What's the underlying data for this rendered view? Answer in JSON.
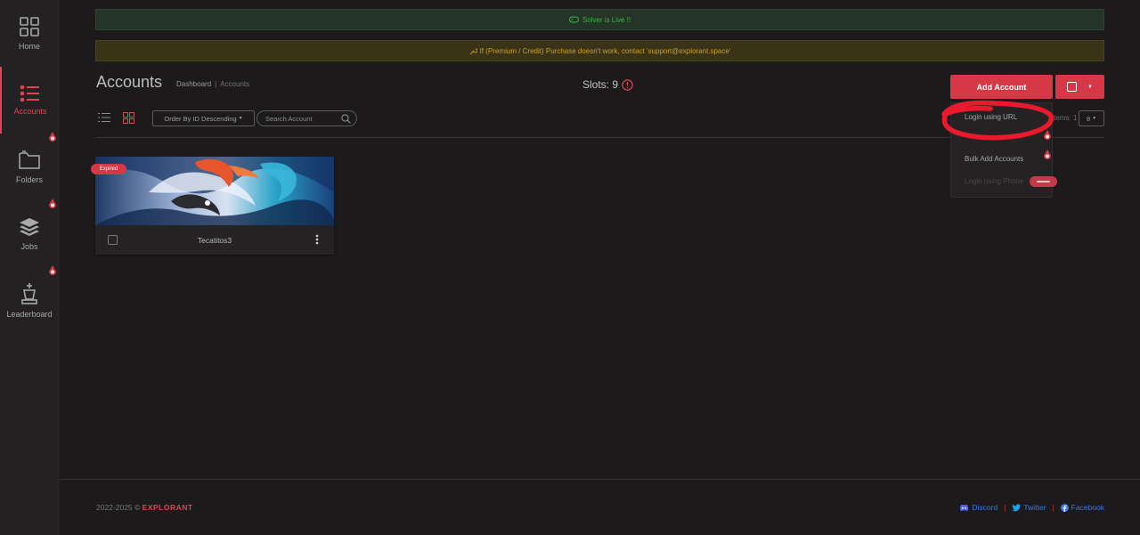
{
  "sidebar": {
    "items": [
      {
        "label": "Home",
        "icon": "grid-icon"
      },
      {
        "label": "Accounts",
        "icon": "list-icon"
      },
      {
        "label": "Folders",
        "icon": "folder-icon"
      },
      {
        "label": "Jobs",
        "icon": "layers-icon"
      },
      {
        "label": "Leaderboard",
        "icon": "chess-king-icon"
      }
    ]
  },
  "banners": {
    "live": "Solver is Live !!",
    "warning": "If (Premium / Credit) Purchase doesn't work, contact 'support@explorant.space'"
  },
  "header": {
    "title": "Accounts",
    "breadcrumb": [
      "Dashboard",
      "Accounts"
    ],
    "slots_label": "Slots: 9",
    "add_button": "Add Account"
  },
  "toolbar": {
    "order_select": "Order By ID Descending",
    "search_placeholder": "Search Account",
    "items_label": "Items: 1",
    "items_per_page": "8"
  },
  "dropdown": {
    "items": [
      "Login using URL",
      "Bulk Add Accounts",
      "Login using Phone"
    ]
  },
  "cards": [
    {
      "name": "Tecatitos3",
      "status": "Expired"
    }
  ],
  "footer": {
    "copyright": "2022-2025 ©",
    "brand": "EXPLORANT",
    "links": [
      "Discord",
      "Twitter",
      "Facebook"
    ]
  },
  "colors": {
    "accent": "#d63847",
    "background": "#1c1a1b",
    "live_green": "#3fb24c",
    "warning_gold": "#c9a227",
    "link_blue": "#3f78e0"
  }
}
